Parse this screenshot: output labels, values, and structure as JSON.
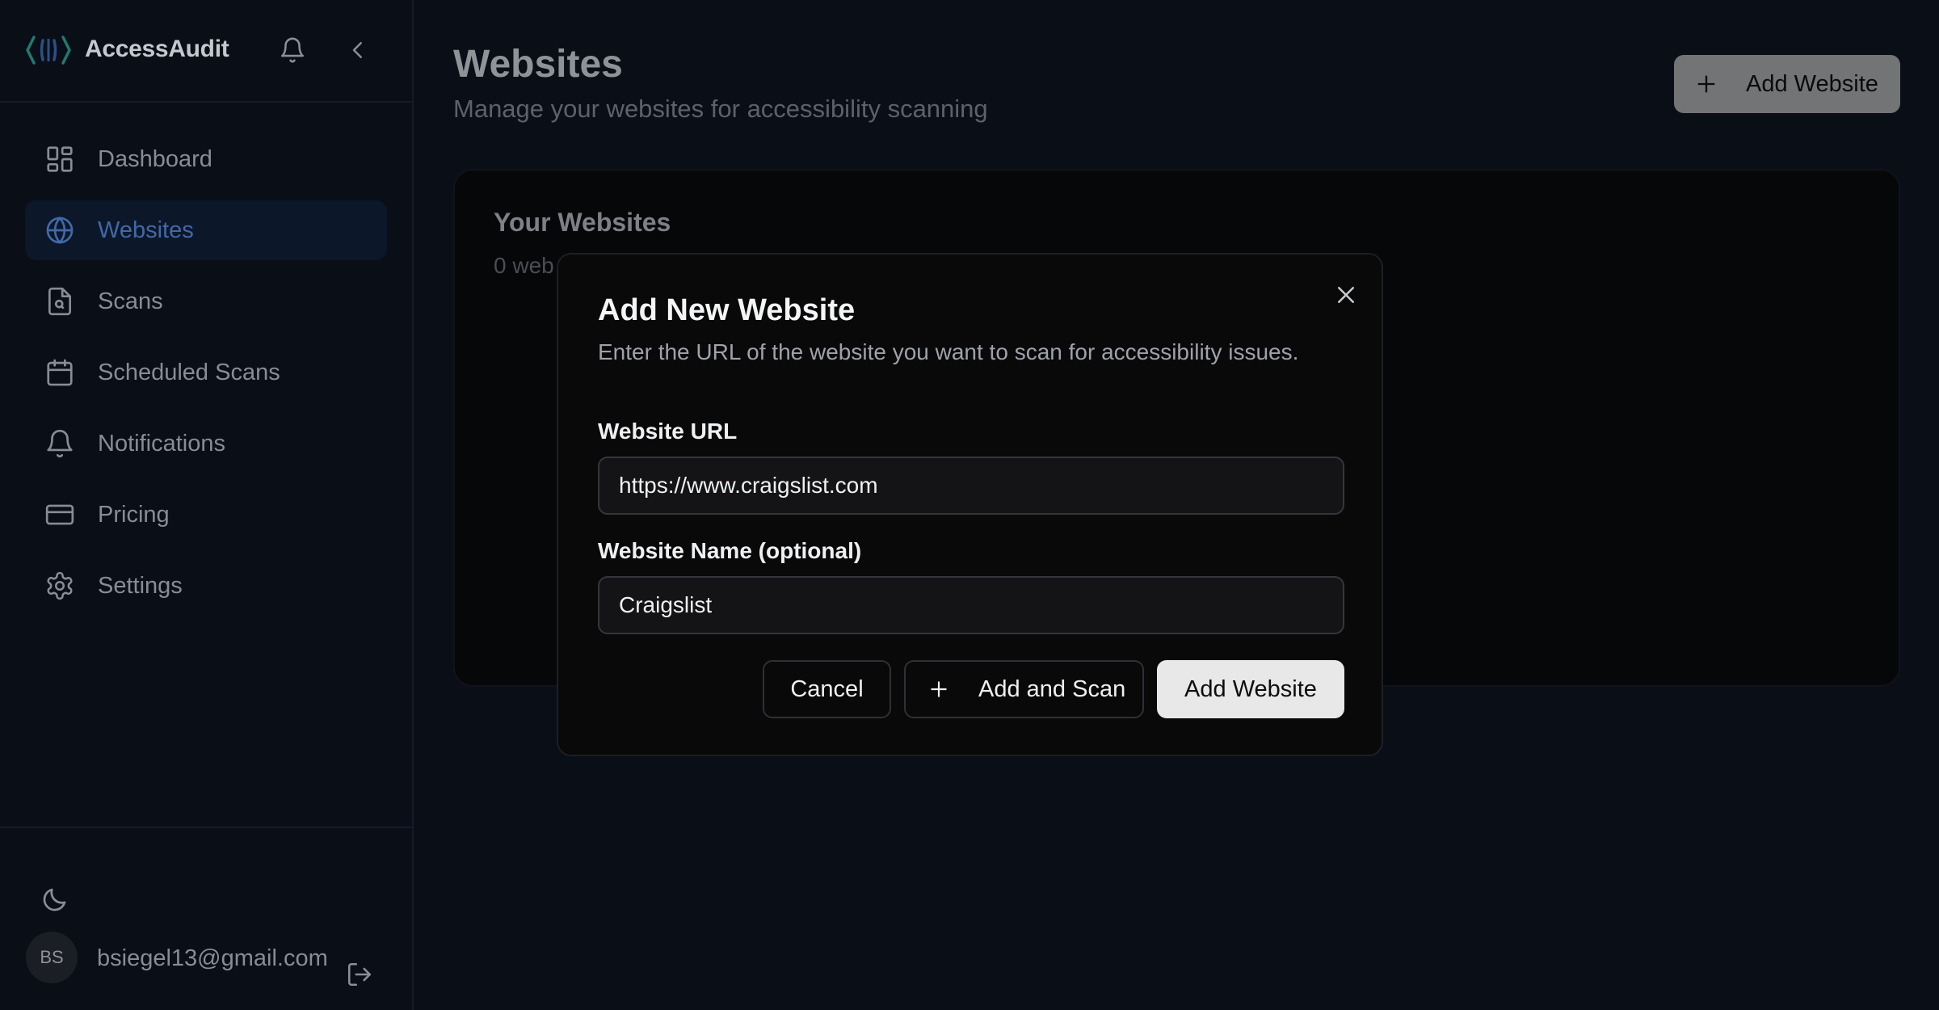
{
  "app": {
    "name": "AccessAudit"
  },
  "sidebar": {
    "items": [
      {
        "label": "Dashboard",
        "icon": "dashboard-icon",
        "active": false
      },
      {
        "label": "Websites",
        "icon": "globe-icon",
        "active": true
      },
      {
        "label": "Scans",
        "icon": "file-search-icon",
        "active": false
      },
      {
        "label": "Scheduled Scans",
        "icon": "calendar-icon",
        "active": false
      },
      {
        "label": "Notifications",
        "icon": "bell-icon",
        "active": false
      },
      {
        "label": "Pricing",
        "icon": "credit-card-icon",
        "active": false
      },
      {
        "label": "Settings",
        "icon": "gear-icon",
        "active": false
      }
    ],
    "user": {
      "initials": "BS",
      "email": "bsiegel13@gmail.com"
    }
  },
  "header": {
    "title": "Websites",
    "subtitle": "Manage your websites for accessibility scanning",
    "add_button": "Add Website"
  },
  "card": {
    "title": "Your Websites",
    "subtitle": "0 web"
  },
  "modal": {
    "title": "Add New Website",
    "description": "Enter the URL of the website you want to scan for accessibility issues.",
    "url_label": "Website URL",
    "url_value": "https://www.craigslist.com",
    "name_label": "Website Name (optional)",
    "name_value": "Craigslist",
    "cancel_label": "Cancel",
    "add_scan_label": "Add and Scan",
    "add_label": "Add Website"
  },
  "colors": {
    "accent": "#4169a6",
    "brand_teal": "#1f7a70",
    "background": "#0a0e17"
  }
}
